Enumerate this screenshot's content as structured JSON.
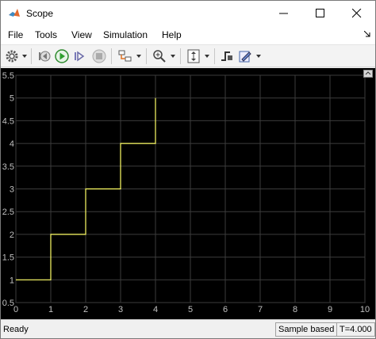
{
  "window": {
    "title": "Scope"
  },
  "menu": [
    "File",
    "Tools",
    "View",
    "Simulation",
    "Help"
  ],
  "toolbar": {
    "buttons": [
      "settings-icon",
      "step-back-icon",
      "run-icon",
      "step-forward-icon",
      "stop-icon",
      "highlight-icon",
      "zoom-icon",
      "scale-axes-icon",
      "triggers-icon",
      "measurements-icon"
    ]
  },
  "status": {
    "ready": "Ready",
    "mode": "Sample based",
    "time": "T=4.000"
  },
  "chart_data": {
    "type": "line",
    "step": true,
    "x": [
      0,
      1,
      1,
      2,
      2,
      3,
      3,
      4,
      4
    ],
    "y": [
      1,
      1,
      2,
      2,
      3,
      3,
      4,
      4,
      5
    ],
    "xlim": [
      0,
      10
    ],
    "ylim": [
      0.5,
      5.5
    ],
    "xticks": [
      "0",
      "1",
      "2",
      "3",
      "4",
      "5",
      "6",
      "7",
      "8",
      "9",
      "10"
    ],
    "yticks": [
      "0.5",
      "1",
      "1.5",
      "2",
      "2.5",
      "3",
      "3.5",
      "4",
      "4.5",
      "5",
      "5.5"
    ],
    "grid": true,
    "line_color": "#ffff66",
    "background": "#000000",
    "tick_color": "#c0c0c0"
  }
}
